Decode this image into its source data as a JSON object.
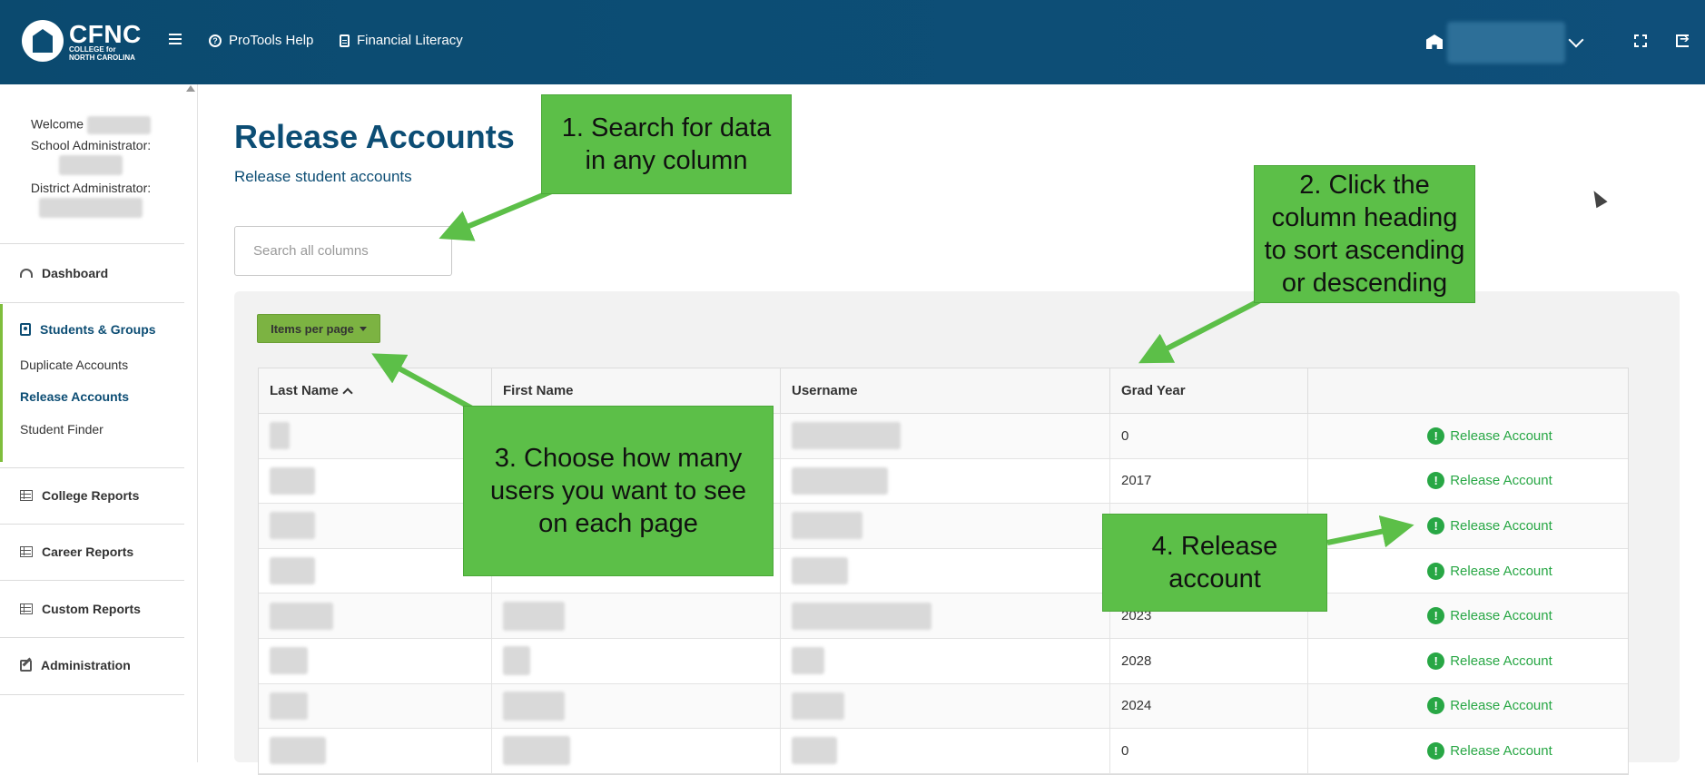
{
  "header": {
    "logo_main": "CFNC",
    "logo_sub1": "COLLEGE for",
    "logo_sub2": "NORTH CAROLINA",
    "nav": [
      {
        "label": "ProTools Help",
        "icon": "question-circle-icon"
      },
      {
        "label": "Financial Literacy",
        "icon": "document-icon"
      }
    ]
  },
  "sidebar": {
    "welcome": "Welcome",
    "school_admin": "School Administrator:",
    "district_admin": "District Administrator:",
    "items": [
      {
        "label": "Dashboard",
        "icon": "dashboard-icon"
      },
      {
        "label": "Students & Groups",
        "icon": "person-card-icon"
      },
      {
        "label": "College Reports",
        "icon": "table-icon"
      },
      {
        "label": "Career Reports",
        "icon": "table-icon"
      },
      {
        "label": "Custom Reports",
        "icon": "table-icon"
      },
      {
        "label": "Administration",
        "icon": "edit-icon"
      }
    ],
    "sub_items": [
      "Duplicate Accounts",
      "Release Accounts",
      "Student Finder"
    ]
  },
  "main": {
    "title": "Release Accounts",
    "subtitle": "Release student accounts",
    "search_placeholder": "Search all columns",
    "items_per_page": "Items per page",
    "columns": [
      "Last Name",
      "First Name",
      "Username",
      "Grad Year",
      ""
    ],
    "action_label": "Release Account",
    "rows": [
      {
        "grad_year": "0"
      },
      {
        "grad_year": "2017"
      },
      {
        "grad_year": ""
      },
      {
        "grad_year": ""
      },
      {
        "grad_year": "2023"
      },
      {
        "grad_year": "2028"
      },
      {
        "grad_year": "2024"
      },
      {
        "grad_year": "0"
      }
    ]
  },
  "callouts": {
    "c1": "1. Search for data in any column",
    "c2": "2. Click the column heading to sort ascending or descending",
    "c3": "3. Choose how many users you want to see on each page",
    "c4": "4. Release account"
  },
  "colors": {
    "header_bg": "#0c4d74",
    "accent_green": "#5cbf48",
    "action_green": "#28a745",
    "button_green": "#7cb342"
  }
}
